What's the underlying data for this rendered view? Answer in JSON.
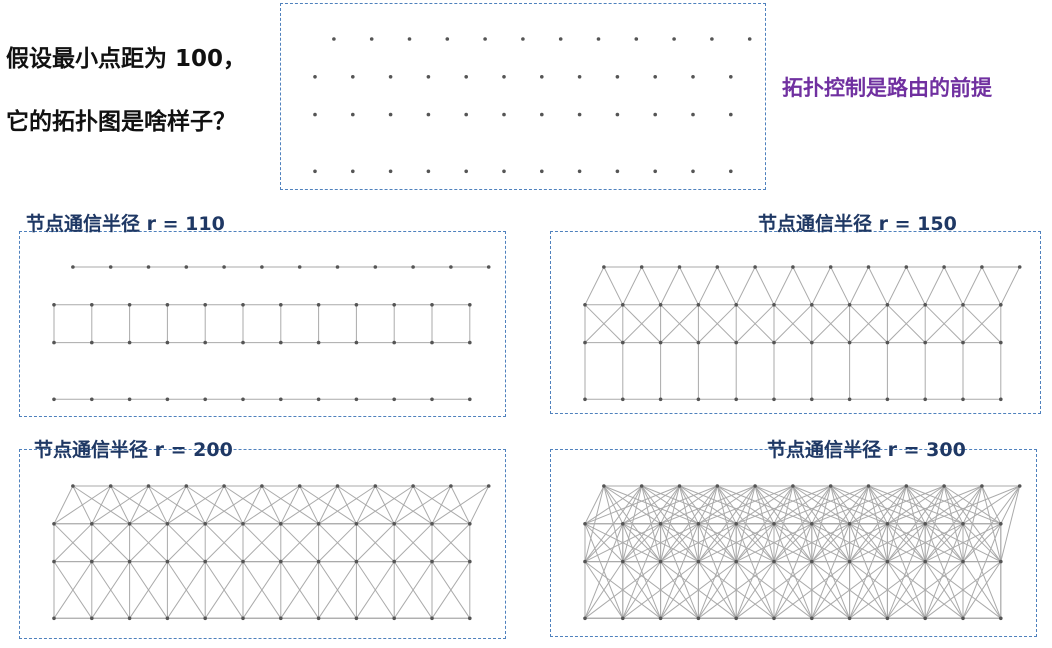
{
  "question": {
    "line1": "假设最小点距为 100，",
    "line2": "它的拓扑图是啥样子？"
  },
  "note": "拓扑控制是路由的前提",
  "panels": [
    {
      "id": "nodes",
      "label": "",
      "radius": null
    },
    {
      "id": "r110",
      "label": "节点通信半径 r = 110",
      "radius": 110
    },
    {
      "id": "r150",
      "label": "节点通信半径 r = 150",
      "radius": 150
    },
    {
      "id": "r200",
      "label": "节点通信半径 r = 200",
      "radius": 200
    },
    {
      "id": "r300",
      "label": "节点通信半径 r = 300",
      "radius": 300
    }
  ],
  "colors": {
    "question_text": "#111111",
    "note_text": "#7030a0",
    "caption_text": "#1f3864",
    "box_border": "#4f81bd",
    "edge": "#aaaaaa",
    "node": "#555555"
  }
}
